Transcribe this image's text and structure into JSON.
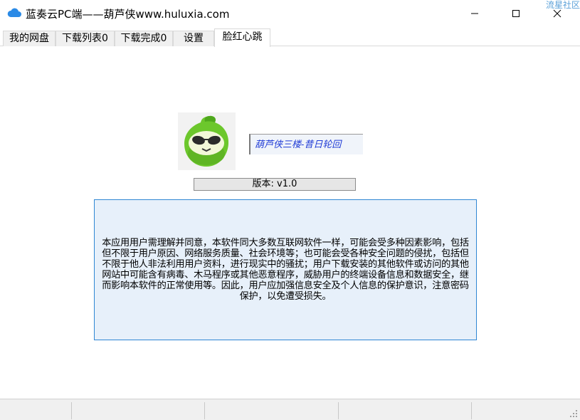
{
  "window": {
    "title": "蓝奏云PC端——葫芦侠www.huluxia.com",
    "watermark": "流星社区",
    "controls": [
      "minimize",
      "maximize",
      "close"
    ],
    "icon": "cloud-icon"
  },
  "tabs": [
    {
      "label": "我的网盘"
    },
    {
      "label": "下载列表0"
    },
    {
      "label": "下载完成0"
    },
    {
      "label": "设置"
    },
    {
      "label": "脸红心跳",
      "active": true
    }
  ],
  "about": {
    "signature": "葫芦侠三楼-昔日轮回",
    "version": "版本: v1.0",
    "notice": "本应用用户需理解并同意，本软件同大多数互联网软件一样，可能会受多种因素影响，包括但不限于用户原因、网络服务质量、社会环境等；也可能会受各种安全问题的侵扰，包括但不限于他人非法利用用户资料，进行现实中的骚扰；用户下载安装的其他软件或访问的其他网站中可能含有病毒、木马程序或其他恶意程序，威胁用户的终端设备信息和数据安全，继而影响本软件的正常使用等。因此，用户应加强信息安全及个人信息的保护意识，注意密码保护，以免遭受损失。"
  },
  "colors": {
    "accent_border": "#2f86d4",
    "notice_bg": "#e7f0fa",
    "signature_text": "#1f3bd6",
    "logo_green": "#6cc72c"
  }
}
